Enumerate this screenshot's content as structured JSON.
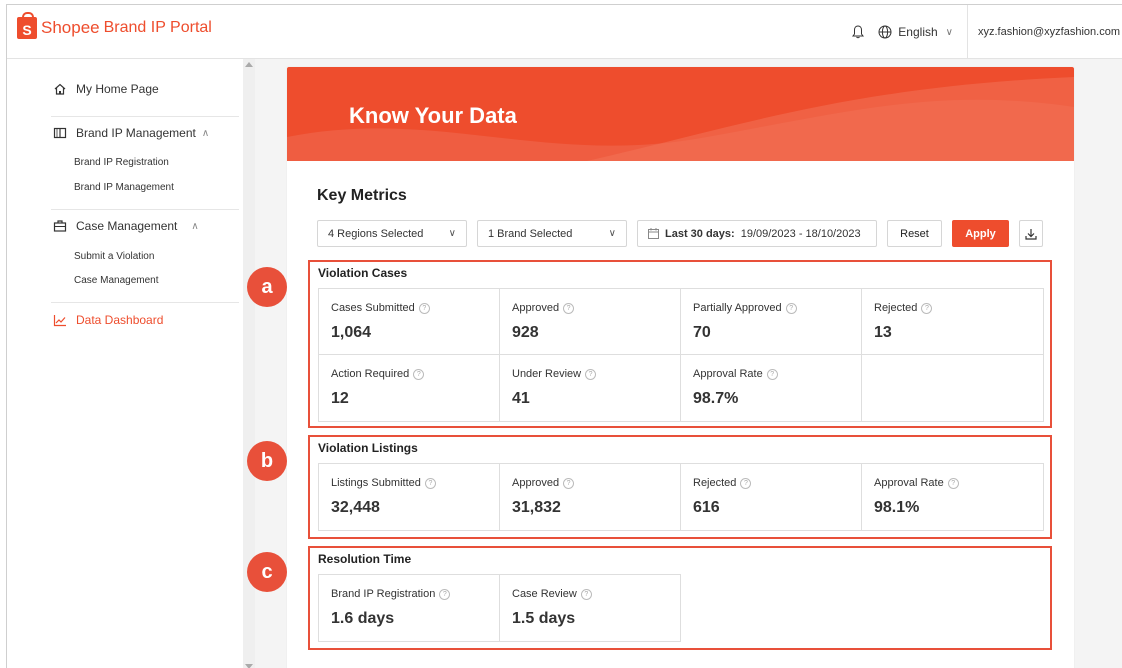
{
  "header": {
    "logo_letter": "S",
    "brand": "Shopee",
    "portal": "Brand IP Portal",
    "language": "English",
    "email": "xyz.fashion@xyzfashion.com"
  },
  "sidebar": {
    "home": "My Home Page",
    "brand_ip": {
      "label": "Brand IP Management",
      "items": [
        "Brand IP Registration",
        "Brand IP Management"
      ]
    },
    "case": {
      "label": "Case Management",
      "items": [
        "Submit a Violation",
        "Case Management"
      ]
    },
    "dashboard": "Data Dashboard"
  },
  "main": {
    "hero_title": "Know Your Data",
    "key_metrics_title": "Key Metrics",
    "filters": {
      "regions": "4 Regions Selected",
      "brand": "1 Brand Selected",
      "date_label": "Last 30 days:",
      "date_range": "19/09/2023 - 18/10/2023",
      "reset": "Reset",
      "apply": "Apply"
    },
    "violation_cases": {
      "title": "Violation Cases",
      "badge": "a",
      "metrics": [
        {
          "label": "Cases Submitted",
          "value": "1,064"
        },
        {
          "label": "Approved",
          "value": "928"
        },
        {
          "label": "Partially Approved",
          "value": "70"
        },
        {
          "label": "Rejected",
          "value": "13"
        },
        {
          "label": "Action Required",
          "value": "12"
        },
        {
          "label": "Under Review",
          "value": "41"
        },
        {
          "label": "Approval Rate",
          "value": "98.7%"
        }
      ]
    },
    "violation_listings": {
      "title": "Violation Listings",
      "badge": "b",
      "metrics": [
        {
          "label": "Listings Submitted",
          "value": "32,448"
        },
        {
          "label": "Approved",
          "value": "31,832"
        },
        {
          "label": "Rejected",
          "value": "616"
        },
        {
          "label": "Approval Rate",
          "value": "98.1%"
        }
      ]
    },
    "resolution_time": {
      "title": "Resolution Time",
      "badge": "c",
      "metrics": [
        {
          "label": "Brand IP Registration",
          "value": "1.6 days"
        },
        {
          "label": "Case Review",
          "value": "1.5 days"
        }
      ]
    }
  },
  "colors": {
    "accent": "#ee4d2d",
    "highlight_border": "#e8503a"
  },
  "icons": [
    "bell-icon",
    "globe-icon",
    "home-icon",
    "book-icon",
    "briefcase-icon",
    "chart-line-icon",
    "calendar-icon",
    "download-icon",
    "help-circle-icon"
  ]
}
